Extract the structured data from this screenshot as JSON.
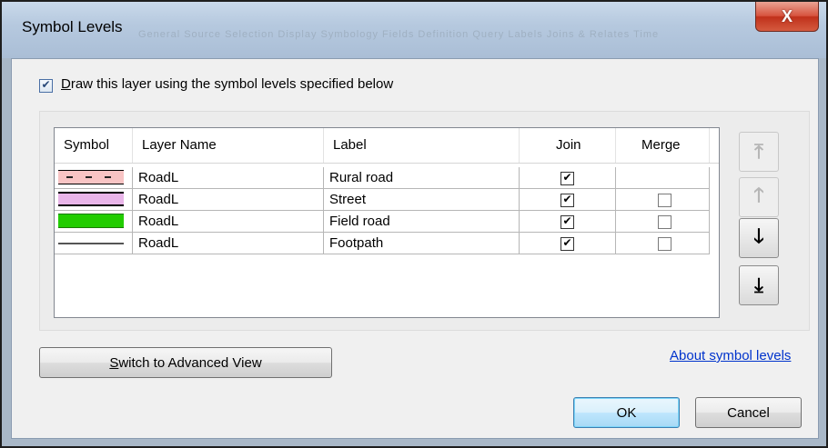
{
  "window": {
    "title": "Symbol Levels",
    "close_glyph": "X",
    "background_tabs": "General  Source  Selection  Display  Symbology  Fields  Definition Query  Labels  Joins & Relates  Time"
  },
  "draw_option": {
    "checked": true,
    "label_underlined": "D",
    "label_rest": "raw this layer using the symbol levels specified below"
  },
  "table": {
    "columns": [
      "Symbol",
      "Layer Name",
      "Label",
      "Join",
      "Merge"
    ],
    "rows": [
      {
        "symbol": "dashed-pink-road",
        "layer": "RoadL",
        "label": "Rural road",
        "join": true,
        "merge": null
      },
      {
        "symbol": "pink-street",
        "layer": "RoadL",
        "label": "Street",
        "join": true,
        "merge": false
      },
      {
        "symbol": "green-field-road",
        "layer": "RoadL",
        "label": "Field road",
        "join": true,
        "merge": false
      },
      {
        "symbol": "thin-gray-path",
        "layer": "RoadL",
        "label": "Footpath",
        "join": true,
        "merge": false
      }
    ]
  },
  "side_buttons": {
    "move_top": "⤒",
    "move_up": "🡑",
    "move_down": "🡓",
    "move_bottom": "⤓"
  },
  "buttons": {
    "advanced_underlined": "S",
    "advanced_rest": "witch to Advanced View",
    "about_link": "About symbol levels",
    "ok": "OK",
    "cancel": "Cancel"
  },
  "colors": {
    "rural_fill": "#f8c4c4",
    "street_fill": "#e9b5e9",
    "field_fill": "#22cc00",
    "link": "#0033cc"
  }
}
